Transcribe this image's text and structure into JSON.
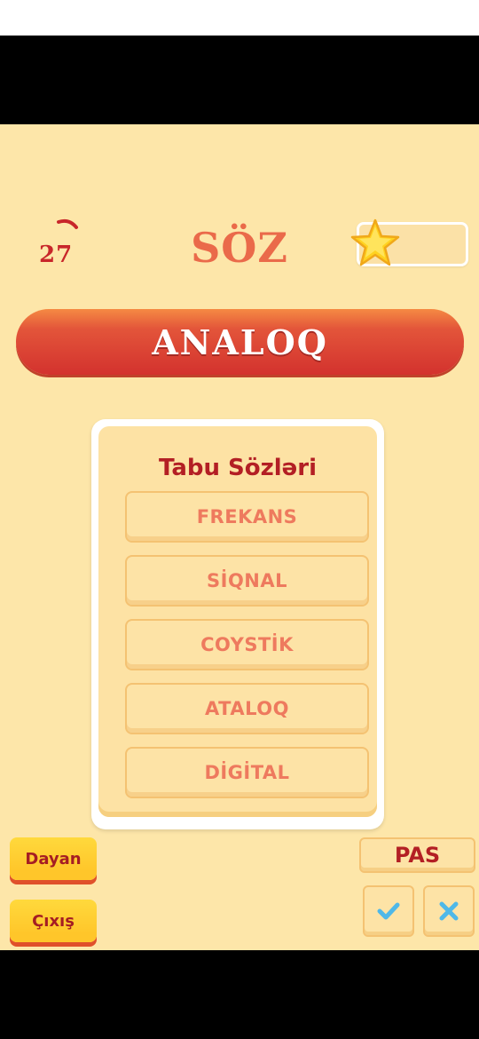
{
  "timer": {
    "value": "27"
  },
  "header": {
    "title": "SÖZ"
  },
  "progress": {
    "fraction": 0
  },
  "word": {
    "text": "ANALOQ"
  },
  "taboo": {
    "heading": "Tabu Sözləri",
    "words": [
      "FREKANS",
      "SİQNAL",
      "COYSTİK",
      "ATALOQ",
      "DİGİTAL"
    ]
  },
  "controls": {
    "pause_label": "Dayan",
    "exit_label": "Çıxış",
    "pass_label": "PAS"
  },
  "colors": {
    "background": "#fde6a9",
    "accent_red": "#c8262a",
    "banner": "#e3553a",
    "taboo_text": "#ee7a5e",
    "correct": "#4fb8e8",
    "wrong": "#4fb8e8"
  },
  "icons": {
    "star": "star-icon",
    "correct": "check-icon",
    "wrong": "close-icon"
  }
}
